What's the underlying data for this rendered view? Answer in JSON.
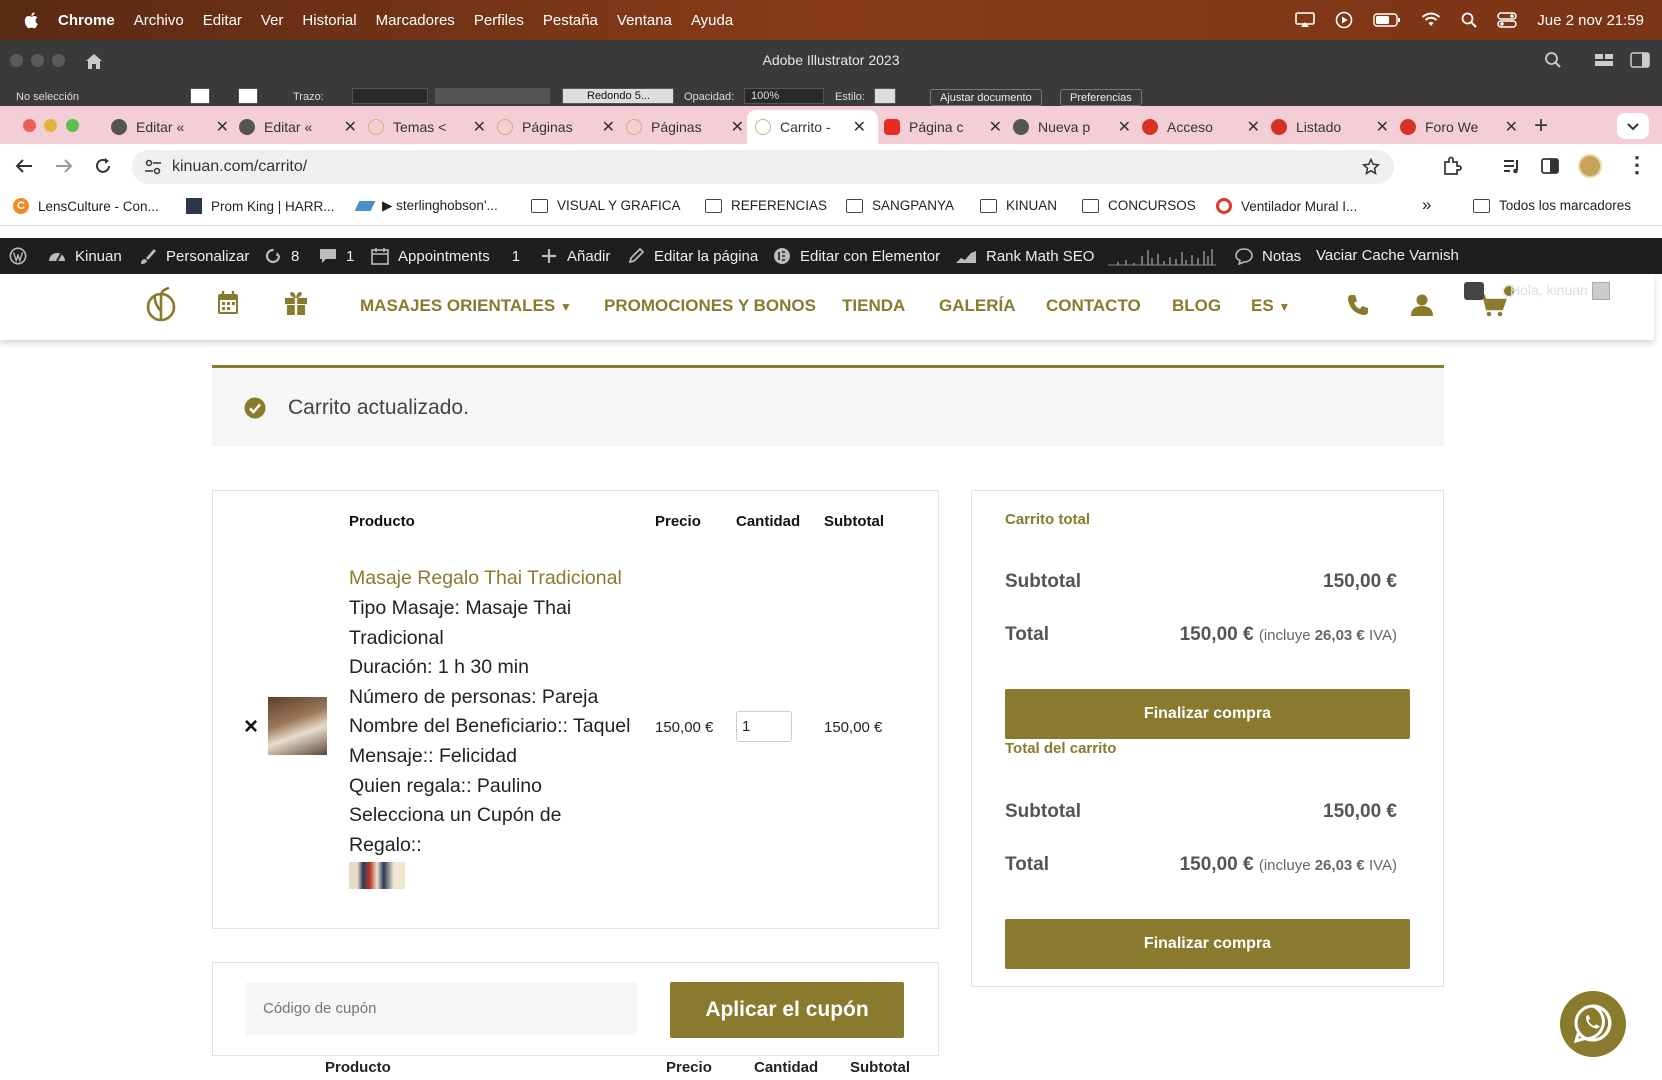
{
  "menubar": {
    "app": "Chrome",
    "items": [
      "Archivo",
      "Editar",
      "Ver",
      "Historial",
      "Marcadores",
      "Perfiles",
      "Pestaña",
      "Ventana",
      "Ayuda"
    ],
    "datetime": "Jue 2 nov 21:59"
  },
  "illustrator": {
    "title": "Adobe Illustrator 2023",
    "selection": "No selección",
    "stroke_label": "Trazo:",
    "brush": "Redondo 5...",
    "opacity_label": "Opacidad:",
    "opacity_value": "100%",
    "style_label": "Estilo:",
    "fit_button": "Ajustar documento",
    "prefs_button": "Preferencias"
  },
  "tabs": [
    {
      "label": "Editar «",
      "icon": "globe-icon"
    },
    {
      "label": "Editar «",
      "icon": "globe-icon"
    },
    {
      "label": "Temas <",
      "icon": "kinuan-icon"
    },
    {
      "label": "Páginas",
      "icon": "kinuan-icon"
    },
    {
      "label": "Páginas",
      "icon": "kinuan-icon"
    },
    {
      "label": "Carrito -",
      "icon": "kinuan-icon"
    },
    {
      "label": "Página c",
      "icon": "youtube-icon"
    },
    {
      "label": "Nueva p",
      "icon": "chrome-icon"
    },
    {
      "label": "Acceso",
      "icon": "wix-icon"
    },
    {
      "label": "Listado",
      "icon": "wix-icon"
    },
    {
      "label": "Foro We",
      "icon": "wix-icon"
    }
  ],
  "address": {
    "url": "kinuan.com/carrito/"
  },
  "bookmarks": [
    {
      "label": "LensCulture - Con...",
      "icon": "lensculture-icon"
    },
    {
      "label": "Prom King | HARR...",
      "icon": "image-icon"
    },
    {
      "label": "▶ sterlinghobson'...",
      "icon": "cloud-icon"
    },
    {
      "label": "VISUAL Y GRAFICA",
      "icon": "folder-icon"
    },
    {
      "label": "REFERENCIAS",
      "icon": "folder-icon"
    },
    {
      "label": "SANGPANYA",
      "icon": "folder-icon"
    },
    {
      "label": "KINUAN",
      "icon": "folder-icon"
    },
    {
      "label": "CONCURSOS",
      "icon": "folder-icon"
    },
    {
      "label": "Ventilador Mural I...",
      "icon": "fan-icon"
    }
  ],
  "bookmarks_all": "Todos los marcadores",
  "wpbar": {
    "site": "Kinuan",
    "customize": "Personalizar",
    "updates": "8",
    "comments": "1",
    "appointments": "Appointments",
    "appointments_count": "1",
    "add": "Añadir",
    "edit_page": "Editar la página",
    "elementor": "Editar con Elementor",
    "rankmath": "Rank Math SEO",
    "notes": "Notas",
    "varnish": "Vaciar Cache Varnish"
  },
  "site_nav": {
    "items": [
      "MASAJES ORIENTALES",
      "PROMOCIONES Y BONOS",
      "TIENDA",
      "GALERÍA",
      "CONTACTO",
      "BLOG",
      "ES"
    ],
    "greeting": "Hola, kinuan"
  },
  "notice": {
    "text": "Carrito actualizado."
  },
  "cart_table": {
    "headers": {
      "product": "Producto",
      "price": "Precio",
      "qty": "Cantidad",
      "subtotal": "Subtotal"
    },
    "item": {
      "name": "Masaje Regalo Thai Tradicional",
      "details": [
        "Tipo Masaje: Masaje Thai",
        "Tradicional",
        "Duración: 1 h 30 min",
        "Número de personas: Pareja",
        "Nombre del Beneficiario:: Taquel",
        "Mensaje:: Felicidad",
        "Quien regala:: Paulino",
        "Selecciona un Cupón de",
        "Regalo::"
      ],
      "price": "150,00 €",
      "qty": "1",
      "subtotal": "150,00 €"
    }
  },
  "totals": [
    {
      "title": "Carrito total",
      "subtotal_label": "Subtotal",
      "subtotal": "150,00 €",
      "total_label": "Total",
      "total": "150,00 €",
      "tax_pre": "(incluye",
      "tax": "26,03 €",
      "tax_post": "IVA)",
      "button": "Finalizar compra"
    },
    {
      "title": "Total del carrito",
      "subtotal_label": "Subtotal",
      "subtotal": "150,00 €",
      "total_label": "Total",
      "total": "150,00 €",
      "tax_pre": "(incluye",
      "tax": "26,03 €",
      "tax_post": "IVA)",
      "button": "Finalizar compra"
    }
  ],
  "coupon": {
    "placeholder": "Código de cupón",
    "button": "Aplicar el cupón"
  },
  "bottom_headers": {
    "product": "Producto",
    "price": "Precio",
    "qty": "Cantidad",
    "subtotal": "Subtotal"
  },
  "colors": {
    "accent": "#8a7a2e",
    "tabbar": "#f3cfd5",
    "menubar": "#7a3416",
    "wpbar": "#1e1e1e",
    "whatsapp": "#8a7a2e"
  }
}
